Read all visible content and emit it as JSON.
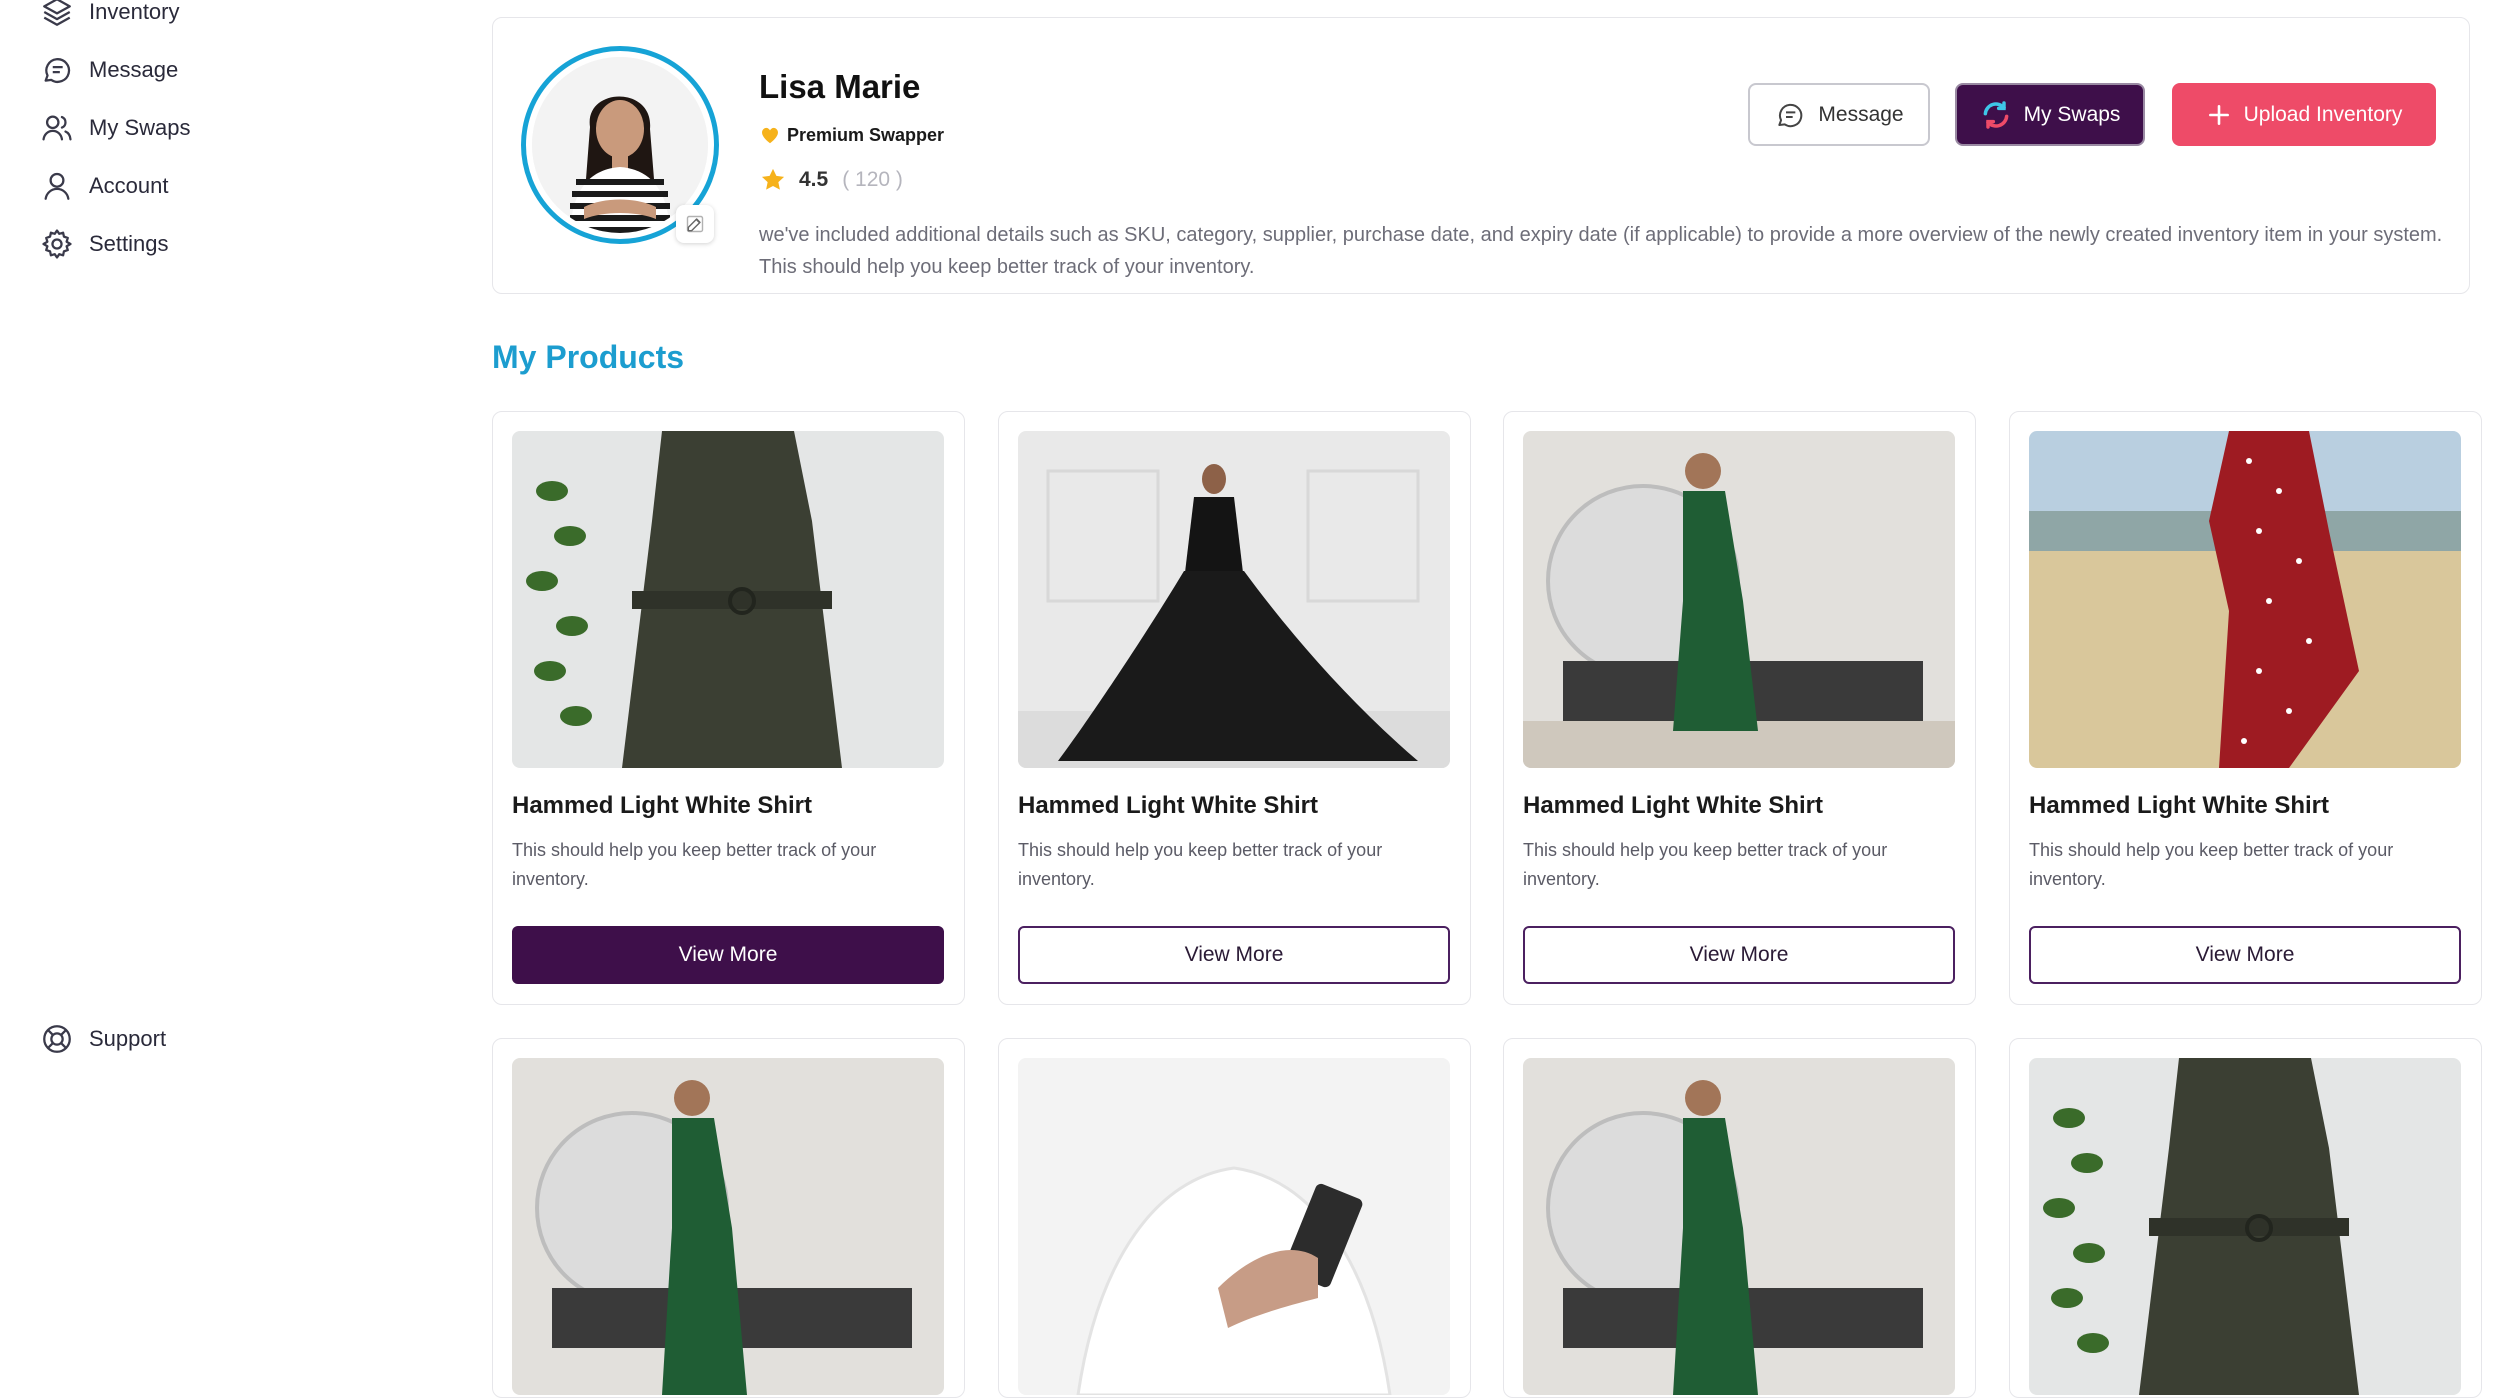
{
  "sidebar": {
    "items": [
      {
        "label": "Inventory"
      },
      {
        "label": "Message"
      },
      {
        "label": "My Swaps"
      },
      {
        "label": "Account"
      },
      {
        "label": "Settings"
      }
    ],
    "support": {
      "label": "Support"
    }
  },
  "profile": {
    "name": "Lisa Marie",
    "badge": "Premium Swapper",
    "rating": "4.5",
    "rating_count": "( 120 )",
    "bio": "we've included additional details such as SKU, category, supplier, purchase date, and expiry date (if applicable) to provide a more overview of the newly created inventory item in your system. This should help you keep better track of your inventory.",
    "buttons": {
      "message": "Message",
      "my_swaps": "My Swaps",
      "upload": "Upload Inventory"
    }
  },
  "products": {
    "title": "My Products",
    "items": [
      {
        "title": "Hammed Light White Shirt",
        "desc": "This should help you keep better track of your inventory.",
        "button": "View More",
        "image": "olive-jumpsuit"
      },
      {
        "title": "Hammed Light White Shirt",
        "desc": "This should help you keep better track of your inventory.",
        "button": "View More",
        "image": "black-ruffle-gown"
      },
      {
        "title": "Hammed Light White Shirt",
        "desc": "This should help you keep better track of your inventory.",
        "button": "View More",
        "image": "green-dress-headphones"
      },
      {
        "title": "Hammed Light White Shirt",
        "desc": "This should help you keep better track of your inventory.",
        "button": "View More",
        "image": "red-polka-dress"
      },
      {
        "title": "",
        "desc": "",
        "button": "",
        "image": "green-dress-headphones"
      },
      {
        "title": "",
        "desc": "",
        "button": "",
        "image": "white-sweater-phone"
      },
      {
        "title": "",
        "desc": "",
        "button": "",
        "image": "green-dress-headphones"
      },
      {
        "title": "",
        "desc": "",
        "button": "",
        "image": "olive-jumpsuit"
      }
    ]
  },
  "colors": {
    "accent": "#1c9dcf",
    "primary": "#3e0f4a",
    "cta": "#ee4b68"
  }
}
